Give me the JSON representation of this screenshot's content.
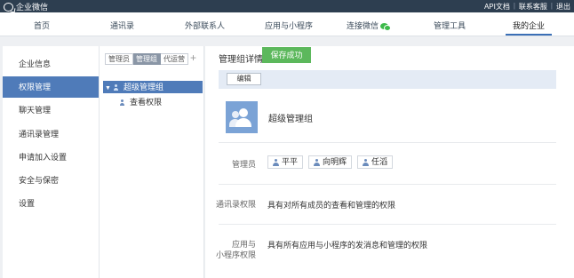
{
  "topbar": {
    "brand": "企业微信",
    "links": [
      "API文档",
      "联系客服",
      "退出"
    ]
  },
  "nav": {
    "items": [
      "首页",
      "通讯录",
      "外部联系人",
      "应用与小程序",
      "连接微信",
      "管理工具",
      "我的企业"
    ],
    "active": "我的企业"
  },
  "sidebar": {
    "items": [
      "企业信息",
      "权限管理",
      "聊天管理",
      "通讯录管理",
      "申请加入设置",
      "安全与保密",
      "设置"
    ],
    "active": "权限管理"
  },
  "tree": {
    "tabs": [
      "管理员",
      "管理组",
      "代运营"
    ],
    "active_tab": "管理组",
    "add": "+",
    "root": "超级管理组",
    "child": "查看权限"
  },
  "detail": {
    "title": "管理组详情",
    "toast": "保存成功",
    "edit": "编辑",
    "group_name": "超级管理组",
    "admins_label": "管理员",
    "admins": [
      "平平",
      "向明辉",
      "任滔"
    ],
    "contacts_label": "通讯录权限",
    "contacts_value": "具有对所有成员的查看和管理的权限",
    "apps_label_1": "应用与",
    "apps_label_2": "小程序权限",
    "apps_value": "具有所有应用与小程序的发消息和管理的权限"
  },
  "colors": {
    "topbar": "#2d3e50",
    "accent": "#4f7bb9",
    "success": "#5cb85c"
  }
}
